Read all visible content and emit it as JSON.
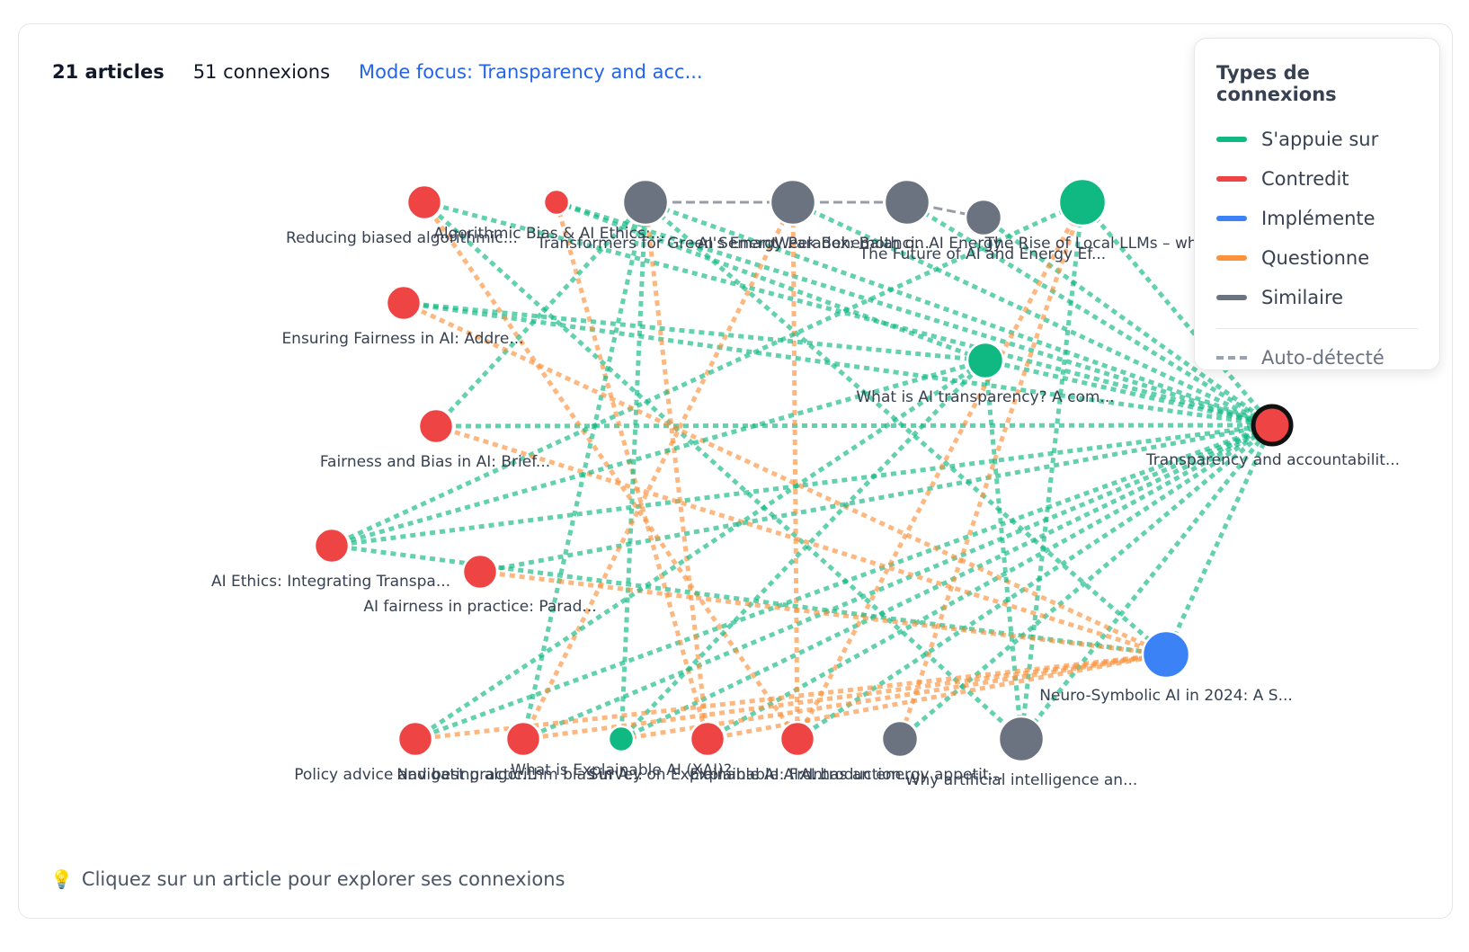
{
  "stats": {
    "articles": "21 articles",
    "connections": "51 connexions",
    "focus_mode": "Mode focus: Transparency and acc..."
  },
  "legend": {
    "title": "Types de connexions",
    "items": [
      {
        "label": "S'appuie sur",
        "color": "#10b981"
      },
      {
        "label": "Contredit",
        "color": "#ef4444"
      },
      {
        "label": "Implémente",
        "color": "#3b82f6"
      },
      {
        "label": "Questionne",
        "color": "#fb923c"
      },
      {
        "label": "Similaire",
        "color": "#6b7280"
      }
    ],
    "auto_label": "Auto-détecté"
  },
  "hint": "Cliquez sur un article pour explorer ses connexions",
  "colors": {
    "supports": "#10b981",
    "contradicts": "#ef4444",
    "implements": "#3b82f6",
    "questions": "#fb923c",
    "similar": "#6b7280"
  },
  "graph": {
    "focus": "transparency",
    "nodes": [
      {
        "id": "reducing",
        "label": "Reducing biased algorithmic...",
        "type": "contradicts"
      },
      {
        "id": "algbias",
        "label": "Algorithmic Bias & AI Ethics:...",
        "type": "contradicts"
      },
      {
        "id": "transformers",
        "label": "Transformers for Green Semant...",
        "type": "similar"
      },
      {
        "id": "energy",
        "label": "AI's Energy Paradox: Balanci...",
        "type": "similar"
      },
      {
        "id": "weekbeh",
        "label": "Week Behemoth on AI Energy...",
        "type": "similar"
      },
      {
        "id": "future",
        "label": "The Future of AI and Energy Ef...",
        "type": "similar"
      },
      {
        "id": "locallm",
        "label": "The Rise of Local LLMs – what ...",
        "type": "supports"
      },
      {
        "id": "ensuring",
        "label": "Ensuring Fairness in AI: Addre...",
        "type": "contradicts"
      },
      {
        "id": "whatis",
        "label": "What is AI transparency? A com...",
        "type": "supports"
      },
      {
        "id": "fairness",
        "label": "Fairness and Bias in AI: Brief...",
        "type": "contradicts"
      },
      {
        "id": "transparency",
        "label": "Transparency and accountabilit...",
        "type": "contradicts"
      },
      {
        "id": "ethics",
        "label": "AI Ethics: Integrating Transpa...",
        "type": "contradicts"
      },
      {
        "id": "practice",
        "label": "AI fairness in practice: Parad...",
        "type": "contradicts"
      },
      {
        "id": "neuro",
        "label": "Neuro-Symbolic AI in 2024: A S...",
        "type": "implements"
      },
      {
        "id": "policy",
        "label": "Policy advice and best practic...",
        "type": "contradicts"
      },
      {
        "id": "navigating",
        "label": "Navigating algorithm bias in A...",
        "type": "contradicts"
      },
      {
        "id": "xai",
        "label": "What is Explainable AI (XAI)?",
        "type": "supports"
      },
      {
        "id": "survey",
        "label": "Survey on Explainable AI: Fro...",
        "type": "contradicts"
      },
      {
        "id": "xaiintro",
        "label": "Explainable AI: Introduction...",
        "type": "contradicts"
      },
      {
        "id": "appetite",
        "label": "AI has an energy appetit...",
        "type": "similar"
      },
      {
        "id": "whyai",
        "label": "Why artificial intelligence an...",
        "type": "similar"
      }
    ],
    "edges": [
      {
        "source": "transformers",
        "target": "energy",
        "type": "similar"
      },
      {
        "source": "energy",
        "target": "weekbeh",
        "type": "similar"
      },
      {
        "source": "weekbeh",
        "target": "future",
        "type": "similar"
      },
      {
        "source": "reducing",
        "target": "transparency",
        "type": "supports"
      },
      {
        "source": "algbias",
        "target": "transparency",
        "type": "supports"
      },
      {
        "source": "transformers",
        "target": "transparency",
        "type": "supports"
      },
      {
        "source": "energy",
        "target": "transparency",
        "type": "supports"
      },
      {
        "source": "weekbeh",
        "target": "transparency",
        "type": "supports"
      },
      {
        "source": "future",
        "target": "transparency",
        "type": "supports"
      },
      {
        "source": "locallm",
        "target": "transparency",
        "type": "supports"
      },
      {
        "source": "ensuring",
        "target": "transparency",
        "type": "supports"
      },
      {
        "source": "whatis",
        "target": "transparency",
        "type": "supports"
      },
      {
        "source": "fairness",
        "target": "transparency",
        "type": "supports"
      },
      {
        "source": "ethics",
        "target": "transparency",
        "type": "supports"
      },
      {
        "source": "practice",
        "target": "transparency",
        "type": "supports"
      },
      {
        "source": "neuro",
        "target": "transparency",
        "type": "supports"
      },
      {
        "source": "policy",
        "target": "transparency",
        "type": "supports"
      },
      {
        "source": "navigating",
        "target": "transparency",
        "type": "supports"
      },
      {
        "source": "xai",
        "target": "transparency",
        "type": "supports"
      },
      {
        "source": "survey",
        "target": "transparency",
        "type": "supports"
      },
      {
        "source": "xaiintro",
        "target": "transparency",
        "type": "supports"
      },
      {
        "source": "appetite",
        "target": "transparency",
        "type": "supports"
      },
      {
        "source": "whyai",
        "target": "transparency",
        "type": "supports"
      },
      {
        "source": "reducing",
        "target": "whyai",
        "type": "supports"
      },
      {
        "source": "reducing",
        "target": "xaiintro",
        "type": "questions"
      },
      {
        "source": "algbias",
        "target": "survey",
        "type": "questions"
      },
      {
        "source": "algbias",
        "target": "whatis",
        "type": "supports"
      },
      {
        "source": "transformers",
        "target": "xai",
        "type": "supports"
      },
      {
        "source": "transformers",
        "target": "navigating",
        "type": "supports"
      },
      {
        "source": "transformers",
        "target": "neuro",
        "type": "supports"
      },
      {
        "source": "transformers",
        "target": "survey",
        "type": "questions"
      },
      {
        "source": "fairness",
        "target": "transformers",
        "type": "supports"
      },
      {
        "source": "energy",
        "target": "navigating",
        "type": "questions"
      },
      {
        "source": "energy",
        "target": "xaiintro",
        "type": "questions"
      },
      {
        "source": "locallm",
        "target": "ethics",
        "type": "supports"
      },
      {
        "source": "locallm",
        "target": "xaiintro",
        "type": "questions"
      },
      {
        "source": "locallm",
        "target": "appetite",
        "type": "questions"
      },
      {
        "source": "locallm",
        "target": "whyai",
        "type": "supports"
      },
      {
        "source": "ensuring",
        "target": "whatis",
        "type": "supports"
      },
      {
        "source": "ensuring",
        "target": "neuro",
        "type": "questions"
      },
      {
        "source": "whatis",
        "target": "xai",
        "type": "supports"
      },
      {
        "source": "whatis",
        "target": "whyai",
        "type": "supports"
      },
      {
        "source": "fairness",
        "target": "neuro",
        "type": "questions"
      },
      {
        "source": "ethics",
        "target": "whatis",
        "type": "supports"
      },
      {
        "source": "ethics",
        "target": "neuro",
        "type": "supports"
      },
      {
        "source": "practice",
        "target": "neuro",
        "type": "questions"
      },
      {
        "source": "policy",
        "target": "neuro",
        "type": "questions"
      },
      {
        "source": "navigating",
        "target": "neuro",
        "type": "questions"
      },
      {
        "source": "xai",
        "target": "neuro",
        "type": "questions"
      },
      {
        "source": "survey",
        "target": "neuro",
        "type": "questions"
      },
      {
        "source": "policy",
        "target": "whatis",
        "type": "supports"
      }
    ]
  }
}
